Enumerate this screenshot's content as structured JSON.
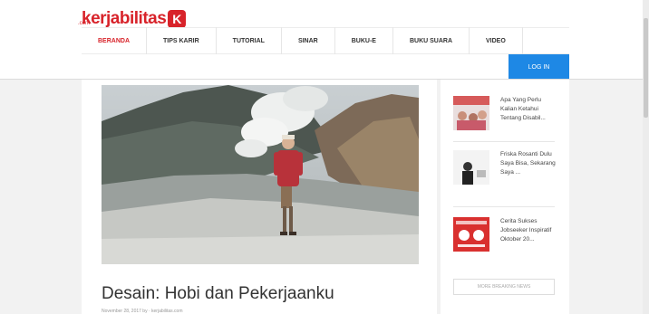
{
  "brand": {
    "name": "kerjabilitas",
    "mark": "K",
    "sub": ".com",
    "color": "#d8232a"
  },
  "nav": {
    "items": [
      "BERANDA",
      "TIPS KARIR",
      "TUTORIAL",
      "SINAR",
      "BUKU-E",
      "BUKU SUARA",
      "VIDEO"
    ],
    "active_index": 0
  },
  "login": {
    "label": "LOG IN",
    "color": "#1e88e5"
  },
  "article": {
    "title": "Desain: Hobi dan Pekerjaanku",
    "meta": "November 28, 2017 by · kerjabilitas.com"
  },
  "sidebar": {
    "items": [
      {
        "text": "Apa Yang Perlu Kalian Ketahui Tentang Disabil...",
        "icon": "group-photo-thumbnail"
      },
      {
        "text": "Friska Rosanti Dulu Saya Bisa, Sekarang Saya ...",
        "icon": "portrait-thumbnail"
      },
      {
        "text": "Cerita Sukses Jobseeker Inspiratif Oktober 20...",
        "icon": "poster-thumbnail"
      }
    ],
    "more_label": "MORE BREAKING NEWS"
  }
}
